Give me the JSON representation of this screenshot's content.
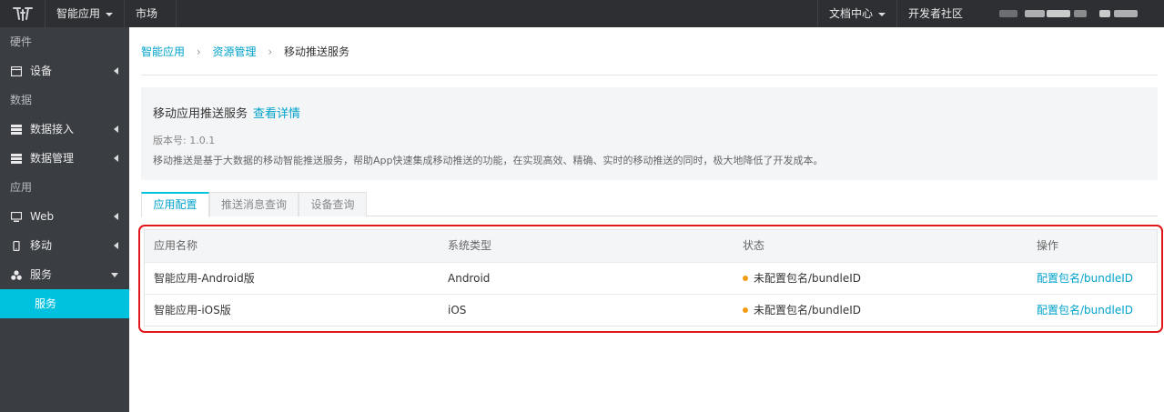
{
  "topbar": {
    "product_menu": "智能应用",
    "market": "市场",
    "docs_menu": "文档中心",
    "community": "开发者社区"
  },
  "sidebar": {
    "groups": [
      {
        "label": "硬件"
      },
      {
        "label": "数据"
      },
      {
        "label": "应用"
      }
    ],
    "items": [
      {
        "label": "设备",
        "icon": "monitor-icon"
      },
      {
        "label": "数据接入",
        "icon": "server-icon"
      },
      {
        "label": "数据管理",
        "icon": "server-icon"
      },
      {
        "label": "Web",
        "icon": "desktop-icon"
      },
      {
        "label": "移动",
        "icon": "mobile-icon"
      },
      {
        "label": "服务",
        "icon": "cubes-icon"
      }
    ],
    "active_sub": "服务"
  },
  "breadcrumb": {
    "items": [
      "智能应用",
      "资源管理",
      "移动推送服务"
    ]
  },
  "info": {
    "title": "移动应用推送服务",
    "detail_link": "查看详情",
    "version": "版本号: 1.0.1",
    "description": "移动推送是基于大数据的移动智能推送服务，帮助App快速集成移动推送的功能，在实现高效、精确、实时的移动推送的同时，极大地降低了开发成本。"
  },
  "tabs": [
    {
      "label": "应用配置",
      "active": true
    },
    {
      "label": "推送消息查询",
      "active": false
    },
    {
      "label": "设备查询",
      "active": false
    }
  ],
  "table": {
    "headers": [
      "应用名称",
      "系统类型",
      "状态",
      "操作"
    ],
    "rows": [
      {
        "name": "智能应用-Android版",
        "os": "Android",
        "status": "未配置包名/bundleID",
        "action": "配置包名/bundleID"
      },
      {
        "name": "智能应用-iOS版",
        "os": "iOS",
        "status": "未配置包名/bundleID",
        "action": "配置包名/bundleID"
      }
    ]
  },
  "colors": {
    "accent": "#00c1de",
    "link": "#00a2ca",
    "warning_dot": "#f39c12",
    "highlight": "#e0161b"
  }
}
